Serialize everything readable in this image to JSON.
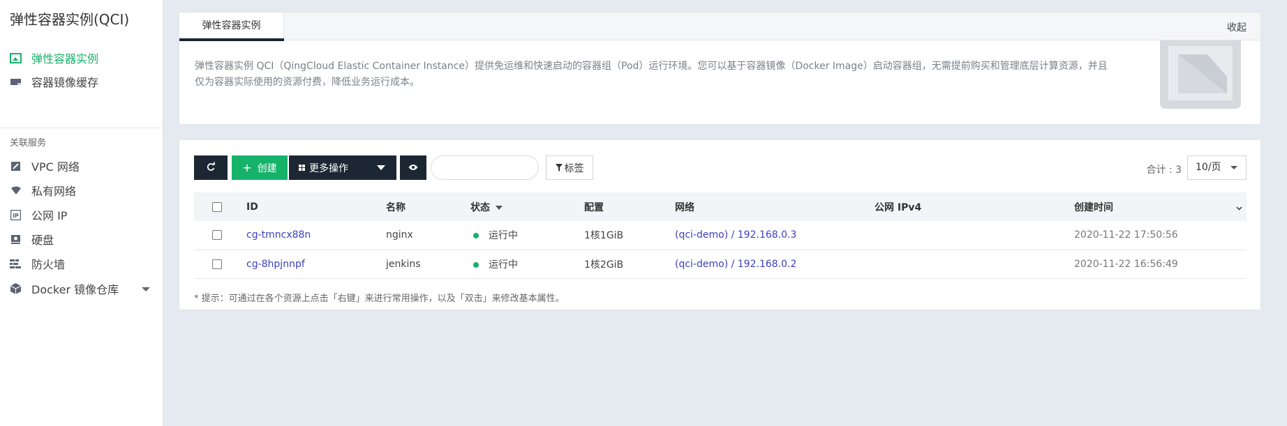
{
  "colors": {
    "accent": "#17b26a",
    "dark_button": "#1c2733",
    "link": "#3d3fbf",
    "page_bg": "#e5eaf0"
  },
  "sidebar": {
    "title": "弹性容器实例(QCI)",
    "items": [
      {
        "label": "弹性容器实例",
        "icon": "monitor-icon",
        "active": true
      },
      {
        "label": "容器镜像缓存",
        "icon": "disk-cache-icon",
        "active": false
      }
    ],
    "section_title": "关联服务",
    "related": [
      {
        "label": "VPC 网络",
        "icon": "pencil-icon"
      },
      {
        "label": "私有网络",
        "icon": "wifi-icon"
      },
      {
        "label": "公网 IP",
        "icon": "ip-icon"
      },
      {
        "label": "硬盘",
        "icon": "hard-disk-icon"
      },
      {
        "label": "防火墙",
        "icon": "firewall-icon"
      },
      {
        "label": "Docker 镜像仓库",
        "icon": "cube-icon"
      }
    ]
  },
  "description": {
    "tab_label": "弹性容器实例",
    "collapse_label": "收起",
    "text": "弹性容器实例 QCI（QingCloud Elastic Container Instance）提供免运维和快速启动的容器组（Pod）运行环境。您可以基于容器镜像（Docker Image）启动容器组，无需提前购买和管理底层计算资源，并且仅为容器实际使用的资源付费，降低业务运行成本。"
  },
  "toolbar": {
    "create_label": "创建",
    "more_label": "更多操作",
    "tag_label": "标签",
    "search_placeholder": "",
    "total_label": "合计 : 3",
    "page_size": "10/页"
  },
  "table": {
    "columns": [
      "ID",
      "名称",
      "状态",
      "配置",
      "网络",
      "公网 IPv4",
      "创建时间"
    ],
    "rows": [
      {
        "id": "cg-tmncx88n",
        "name": "nginx",
        "status": "运行中",
        "config": "1核1GiB",
        "network": "(qci-demo) / 192.168.0.3",
        "public_ip": "",
        "created": "2020-11-22 17:50:56"
      },
      {
        "id": "cg-8hpjnnpf",
        "name": "jenkins",
        "status": "运行中",
        "config": "1核2GiB",
        "network": "(qci-demo) / 192.168.0.2",
        "public_ip": "",
        "created": "2020-11-22 16:56:49"
      }
    ]
  },
  "hint": "* 提示：可通过在各个资源上点击「右键」来进行常用操作，以及「双击」来修改基本属性。"
}
